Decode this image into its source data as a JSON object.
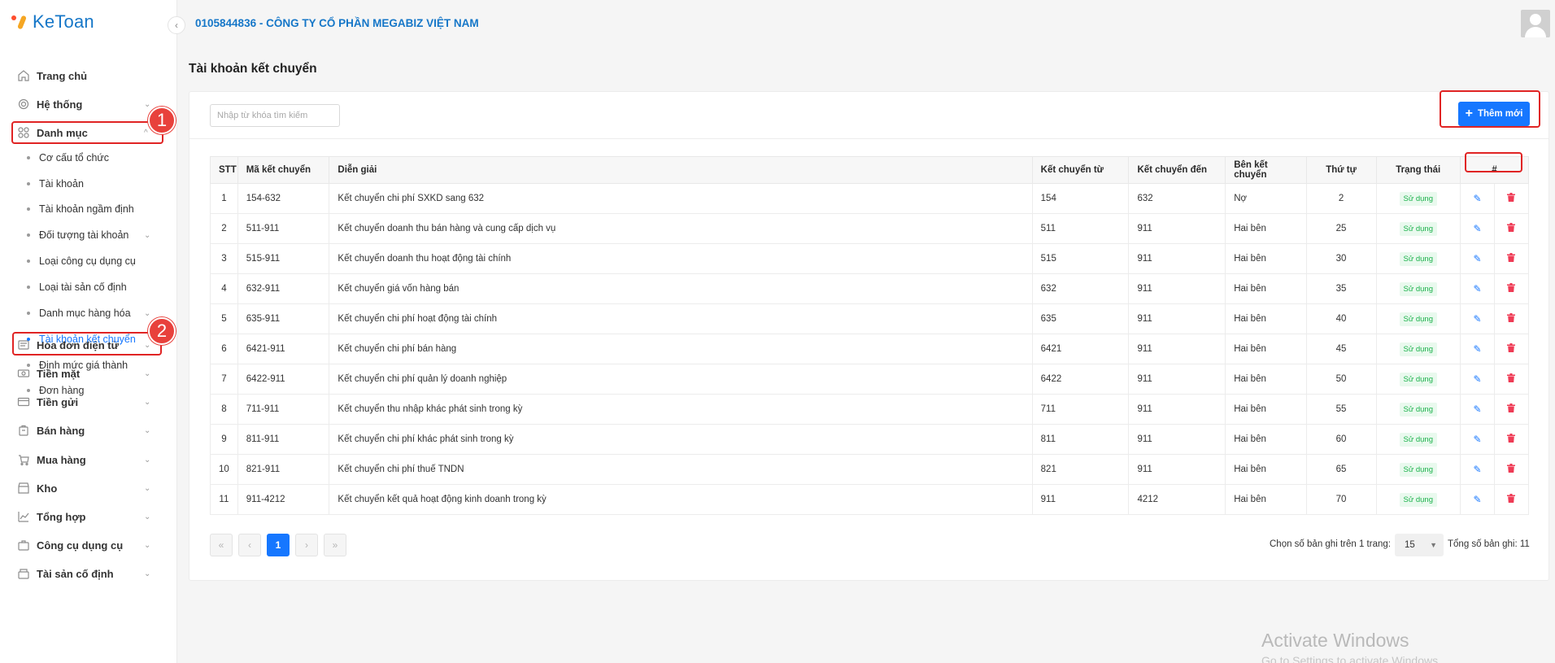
{
  "app": {
    "logo_text": "KeToan",
    "company": "0105844836 - CÔNG TY CỔ PHẦN MEGABIZ VIỆT NAM"
  },
  "sidebar": {
    "items": [
      {
        "label": "Trang chủ",
        "icon": "home-icon",
        "chevron": false
      },
      {
        "label": "Hệ thống",
        "icon": "gear-icon",
        "chevron": true
      },
      {
        "label": "Danh mục",
        "icon": "grid-icon",
        "chevron": true,
        "expanded": true
      },
      {
        "label": "Hóa đơn điện tử",
        "icon": "invoice-icon",
        "chevron": true
      },
      {
        "label": "Tiền mặt",
        "icon": "cash-icon",
        "chevron": true
      },
      {
        "label": "Tiền gửi",
        "icon": "card-icon",
        "chevron": true
      },
      {
        "label": "Bán hàng",
        "icon": "bag-icon",
        "chevron": true
      },
      {
        "label": "Mua hàng",
        "icon": "cart-icon",
        "chevron": true
      },
      {
        "label": "Kho",
        "icon": "store-icon",
        "chevron": true
      },
      {
        "label": "Tổng hợp",
        "icon": "chart-icon",
        "chevron": true
      },
      {
        "label": "Công cụ dụng cụ",
        "icon": "tool-icon",
        "chevron": true
      },
      {
        "label": "Tài sản cố định",
        "icon": "asset-icon",
        "chevron": true
      }
    ],
    "sub_items": [
      {
        "label": "Cơ cấu tổ chức",
        "chevron": false
      },
      {
        "label": "Tài khoản",
        "chevron": false
      },
      {
        "label": "Tài khoản ngầm định",
        "chevron": false
      },
      {
        "label": "Đối tượng tài khoản",
        "chevron": true
      },
      {
        "label": "Loại công cụ dụng cụ",
        "chevron": false
      },
      {
        "label": "Loại tài sản cố định",
        "chevron": false
      },
      {
        "label": "Danh mục hàng hóa",
        "chevron": true
      },
      {
        "label": "Tài khoản kết chuyển",
        "chevron": false,
        "active": true
      },
      {
        "label": "Định mức giá thành",
        "chevron": false
      },
      {
        "label": "Đơn hàng",
        "chevron": false
      }
    ],
    "callouts": [
      "1",
      "2"
    ]
  },
  "page": {
    "title": "Tài khoản kết chuyển",
    "search_placeholder": "Nhập từ khóa tìm kiếm",
    "add_label": "Thêm mới"
  },
  "table": {
    "columns": [
      "STT",
      "Mã kết chuyển",
      "Diễn giải",
      "Kết chuyển từ",
      "Kết chuyển đến",
      "Bên kết chuyển",
      "Thứ tự",
      "Trạng thái",
      "#"
    ],
    "rows": [
      [
        "1",
        "154-632",
        "Kết chuyển chi phí SXKD sang 632",
        "154",
        "632",
        "Nợ",
        "2",
        "Sử dụng"
      ],
      [
        "2",
        "511-911",
        "Kết chuyển doanh thu bán hàng và cung cấp dịch vụ",
        "511",
        "911",
        "Hai bên",
        "25",
        "Sử dụng"
      ],
      [
        "3",
        "515-911",
        "Kết chuyển doanh thu hoạt động tài chính",
        "515",
        "911",
        "Hai bên",
        "30",
        "Sử dụng"
      ],
      [
        "4",
        "632-911",
        "Kết chuyển giá vốn hàng bán",
        "632",
        "911",
        "Hai bên",
        "35",
        "Sử dụng"
      ],
      [
        "5",
        "635-911",
        "Kết chuyển chi phí hoạt động tài chính",
        "635",
        "911",
        "Hai bên",
        "40",
        "Sử dụng"
      ],
      [
        "6",
        "6421-911",
        "Kết chuyển chi phí bán hàng",
        "6421",
        "911",
        "Hai bên",
        "45",
        "Sử dụng"
      ],
      [
        "7",
        "6422-911",
        "Kết chuyển chi phí quản lý doanh nghiệp",
        "6422",
        "911",
        "Hai bên",
        "50",
        "Sử dụng"
      ],
      [
        "8",
        "711-911",
        "Kết chuyển thu nhập khác phát sinh trong kỳ",
        "711",
        "911",
        "Hai bên",
        "55",
        "Sử dụng"
      ],
      [
        "9",
        "811-911",
        "Kết chuyển chi phí khác phát sinh trong kỳ",
        "811",
        "911",
        "Hai bên",
        "60",
        "Sử dụng"
      ],
      [
        "10",
        "821-911",
        "Kết chuyển chi phí thuế TNDN",
        "821",
        "911",
        "Hai bên",
        "65",
        "Sử dụng"
      ],
      [
        "11",
        "911-4212",
        "Kết chuyển kết quả hoạt động kinh doanh trong kỳ",
        "911",
        "4212",
        "Hai bên",
        "70",
        "Sử dụng"
      ]
    ]
  },
  "pagination": {
    "current_page": "1",
    "page_size_label": "Chọn số bản ghi trên 1 trang:",
    "page_size": "15",
    "total_label": "Tổng số bản ghi:",
    "total": "11"
  },
  "watermark": {
    "title": "Activate Windows",
    "subtitle": "Go to Settings to activate Windows."
  },
  "colors": {
    "accent": "#1677ff",
    "brand": "#1677c8",
    "danger": "#ef3b55",
    "success": "#1bb24b",
    "highlight": "#e02424"
  }
}
